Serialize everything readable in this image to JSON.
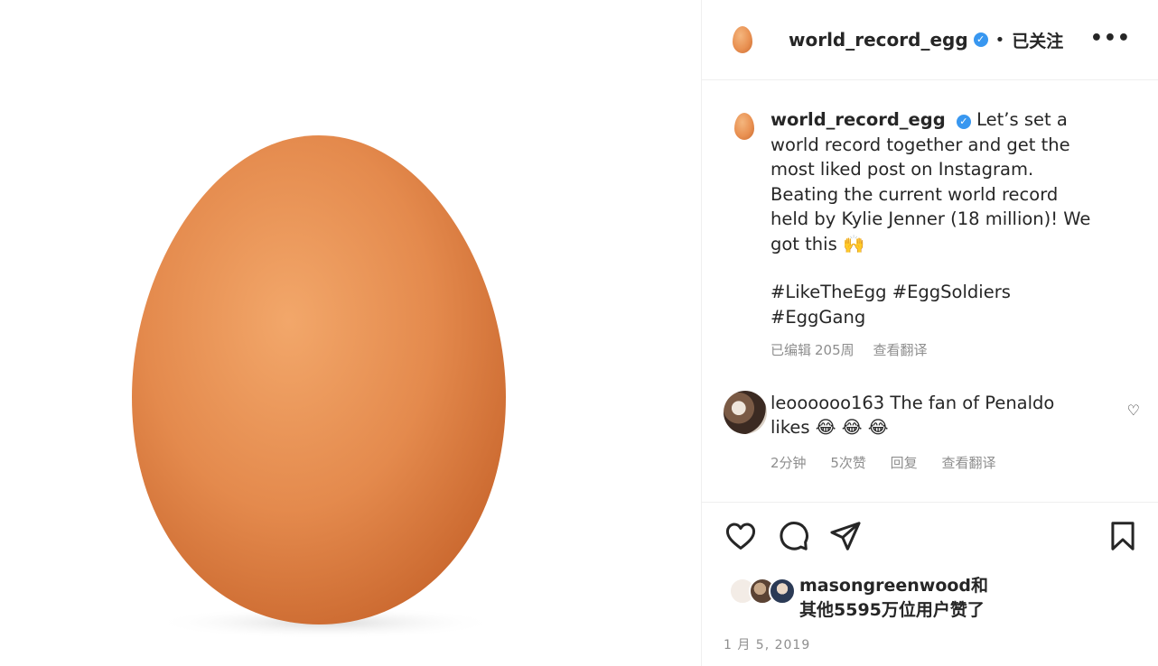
{
  "header": {
    "username": "world_record_egg",
    "follow_status": "已关注",
    "dot": "•",
    "more": "•••"
  },
  "caption": {
    "username": "world_record_egg",
    "text": "Let’s set a world record together and get the most liked post on Instagram. Beating the current world record held by Kylie Jenner (18 million)! We got this",
    "emoji": "🙌",
    "hashtags_line1": "#LikeTheEgg #EggSoldiers",
    "hashtags_line2": "#EggGang",
    "edited": "已编辑",
    "age": "205周",
    "translate": "查看翻译"
  },
  "comment": {
    "username": "leoooooo163",
    "text": "The fan of Penaldo likes",
    "emoji": "😂 😂 😂",
    "age": "2分钟",
    "likes": "5次赞",
    "reply": "回复",
    "translate": "查看翻译"
  },
  "likes": {
    "user": "masongreenwood",
    "and": "和",
    "rest": "其他5595万位用户赞了"
  },
  "post_date": "1 月 5, 2019",
  "colors": {
    "egg": "#e99152",
    "verified": "#3897f0",
    "muted": "#8e8e8e"
  },
  "icons": [
    "more-icon",
    "verified-icon",
    "heart-icon",
    "comment-icon",
    "share-icon",
    "bookmark-icon",
    "heart-small-icon"
  ]
}
